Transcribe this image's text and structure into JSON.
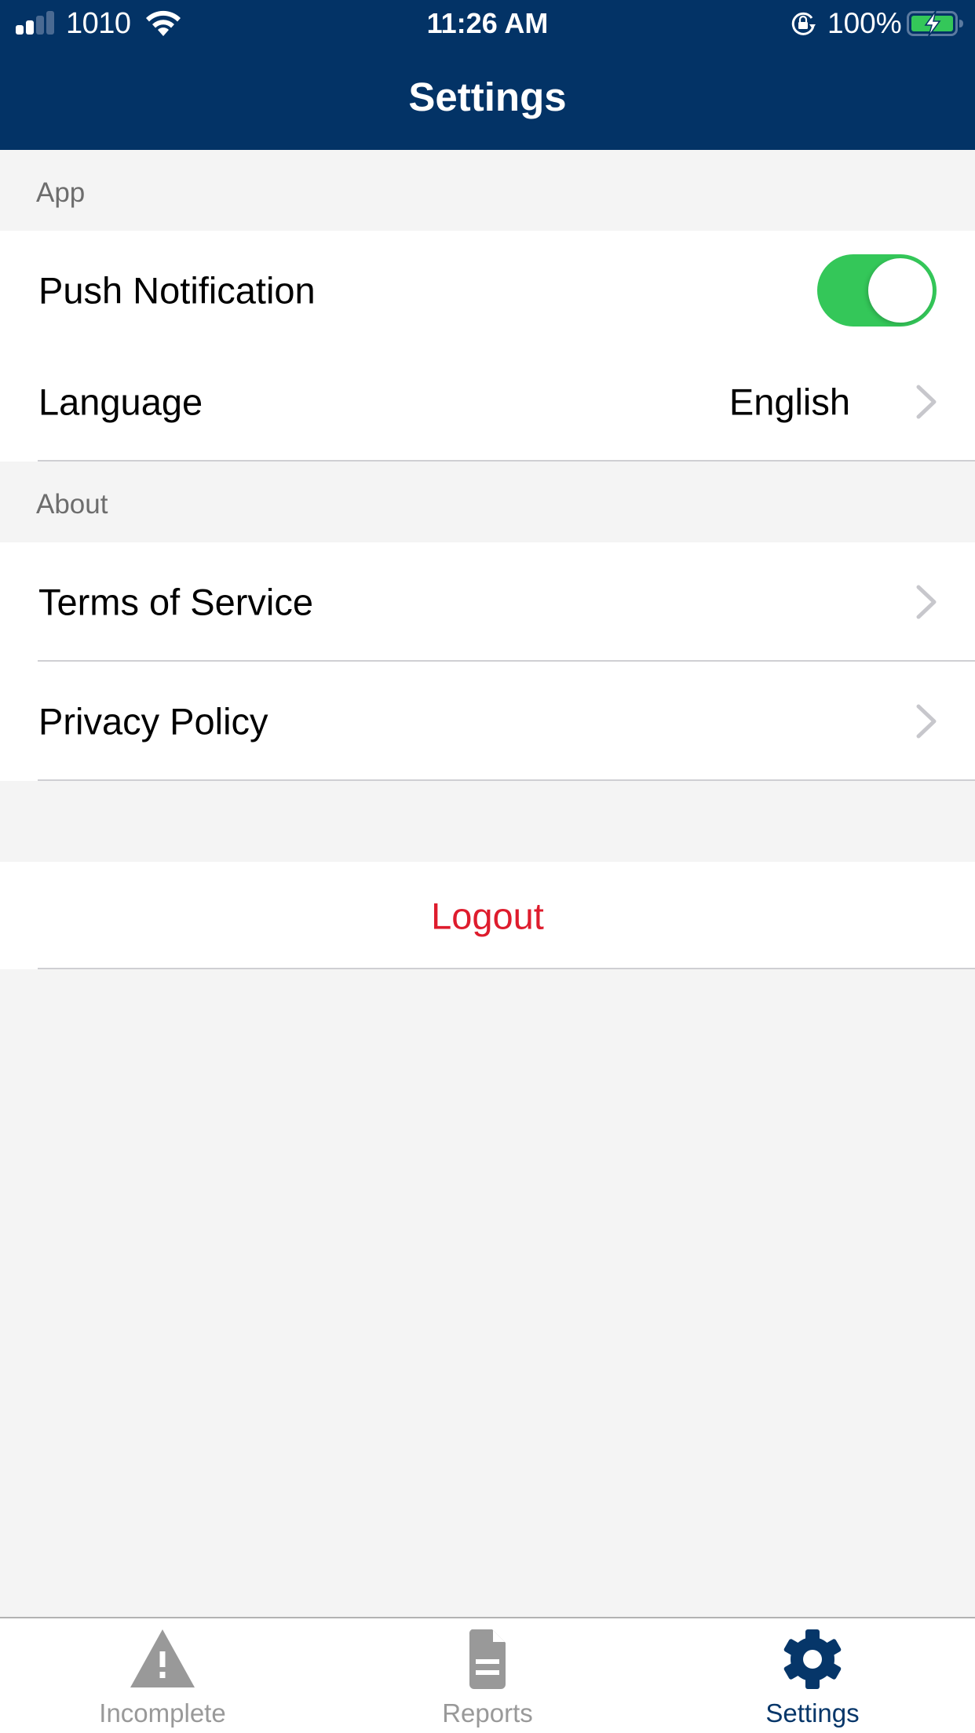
{
  "status_bar": {
    "carrier": "1010",
    "time": "11:26 AM",
    "battery_percent": "100%",
    "signal_bars_filled": 2,
    "signal_bars_total": 4,
    "icons": [
      "signal-icon",
      "wifi-icon",
      "rotation-lock-icon",
      "battery-charging-icon"
    ]
  },
  "nav": {
    "title": "Settings",
    "background_color": "#033366"
  },
  "sections": [
    {
      "header": "App",
      "rows": [
        {
          "label": "Push Notification",
          "type": "toggle",
          "value": true
        },
        {
          "label": "Language",
          "type": "disclosure",
          "value": "English"
        }
      ]
    },
    {
      "header": "About",
      "rows": [
        {
          "label": "Terms of Service",
          "type": "disclosure"
        },
        {
          "label": "Privacy Policy",
          "type": "disclosure"
        }
      ]
    }
  ],
  "logout": {
    "label": "Logout",
    "color": "#de1c2d"
  },
  "tab_bar": {
    "active": "Settings",
    "active_color": "#063669",
    "inactive_color": "#999999",
    "tabs": [
      {
        "label": "Incomplete",
        "icon": "warning-triangle-icon"
      },
      {
        "label": "Reports",
        "icon": "document-icon"
      },
      {
        "label": "Settings",
        "icon": "gear-icon"
      }
    ]
  },
  "colors": {
    "toggle_on": "#34c759",
    "chevron": "#c7c7cc",
    "section_bg": "#f4f4f4"
  }
}
